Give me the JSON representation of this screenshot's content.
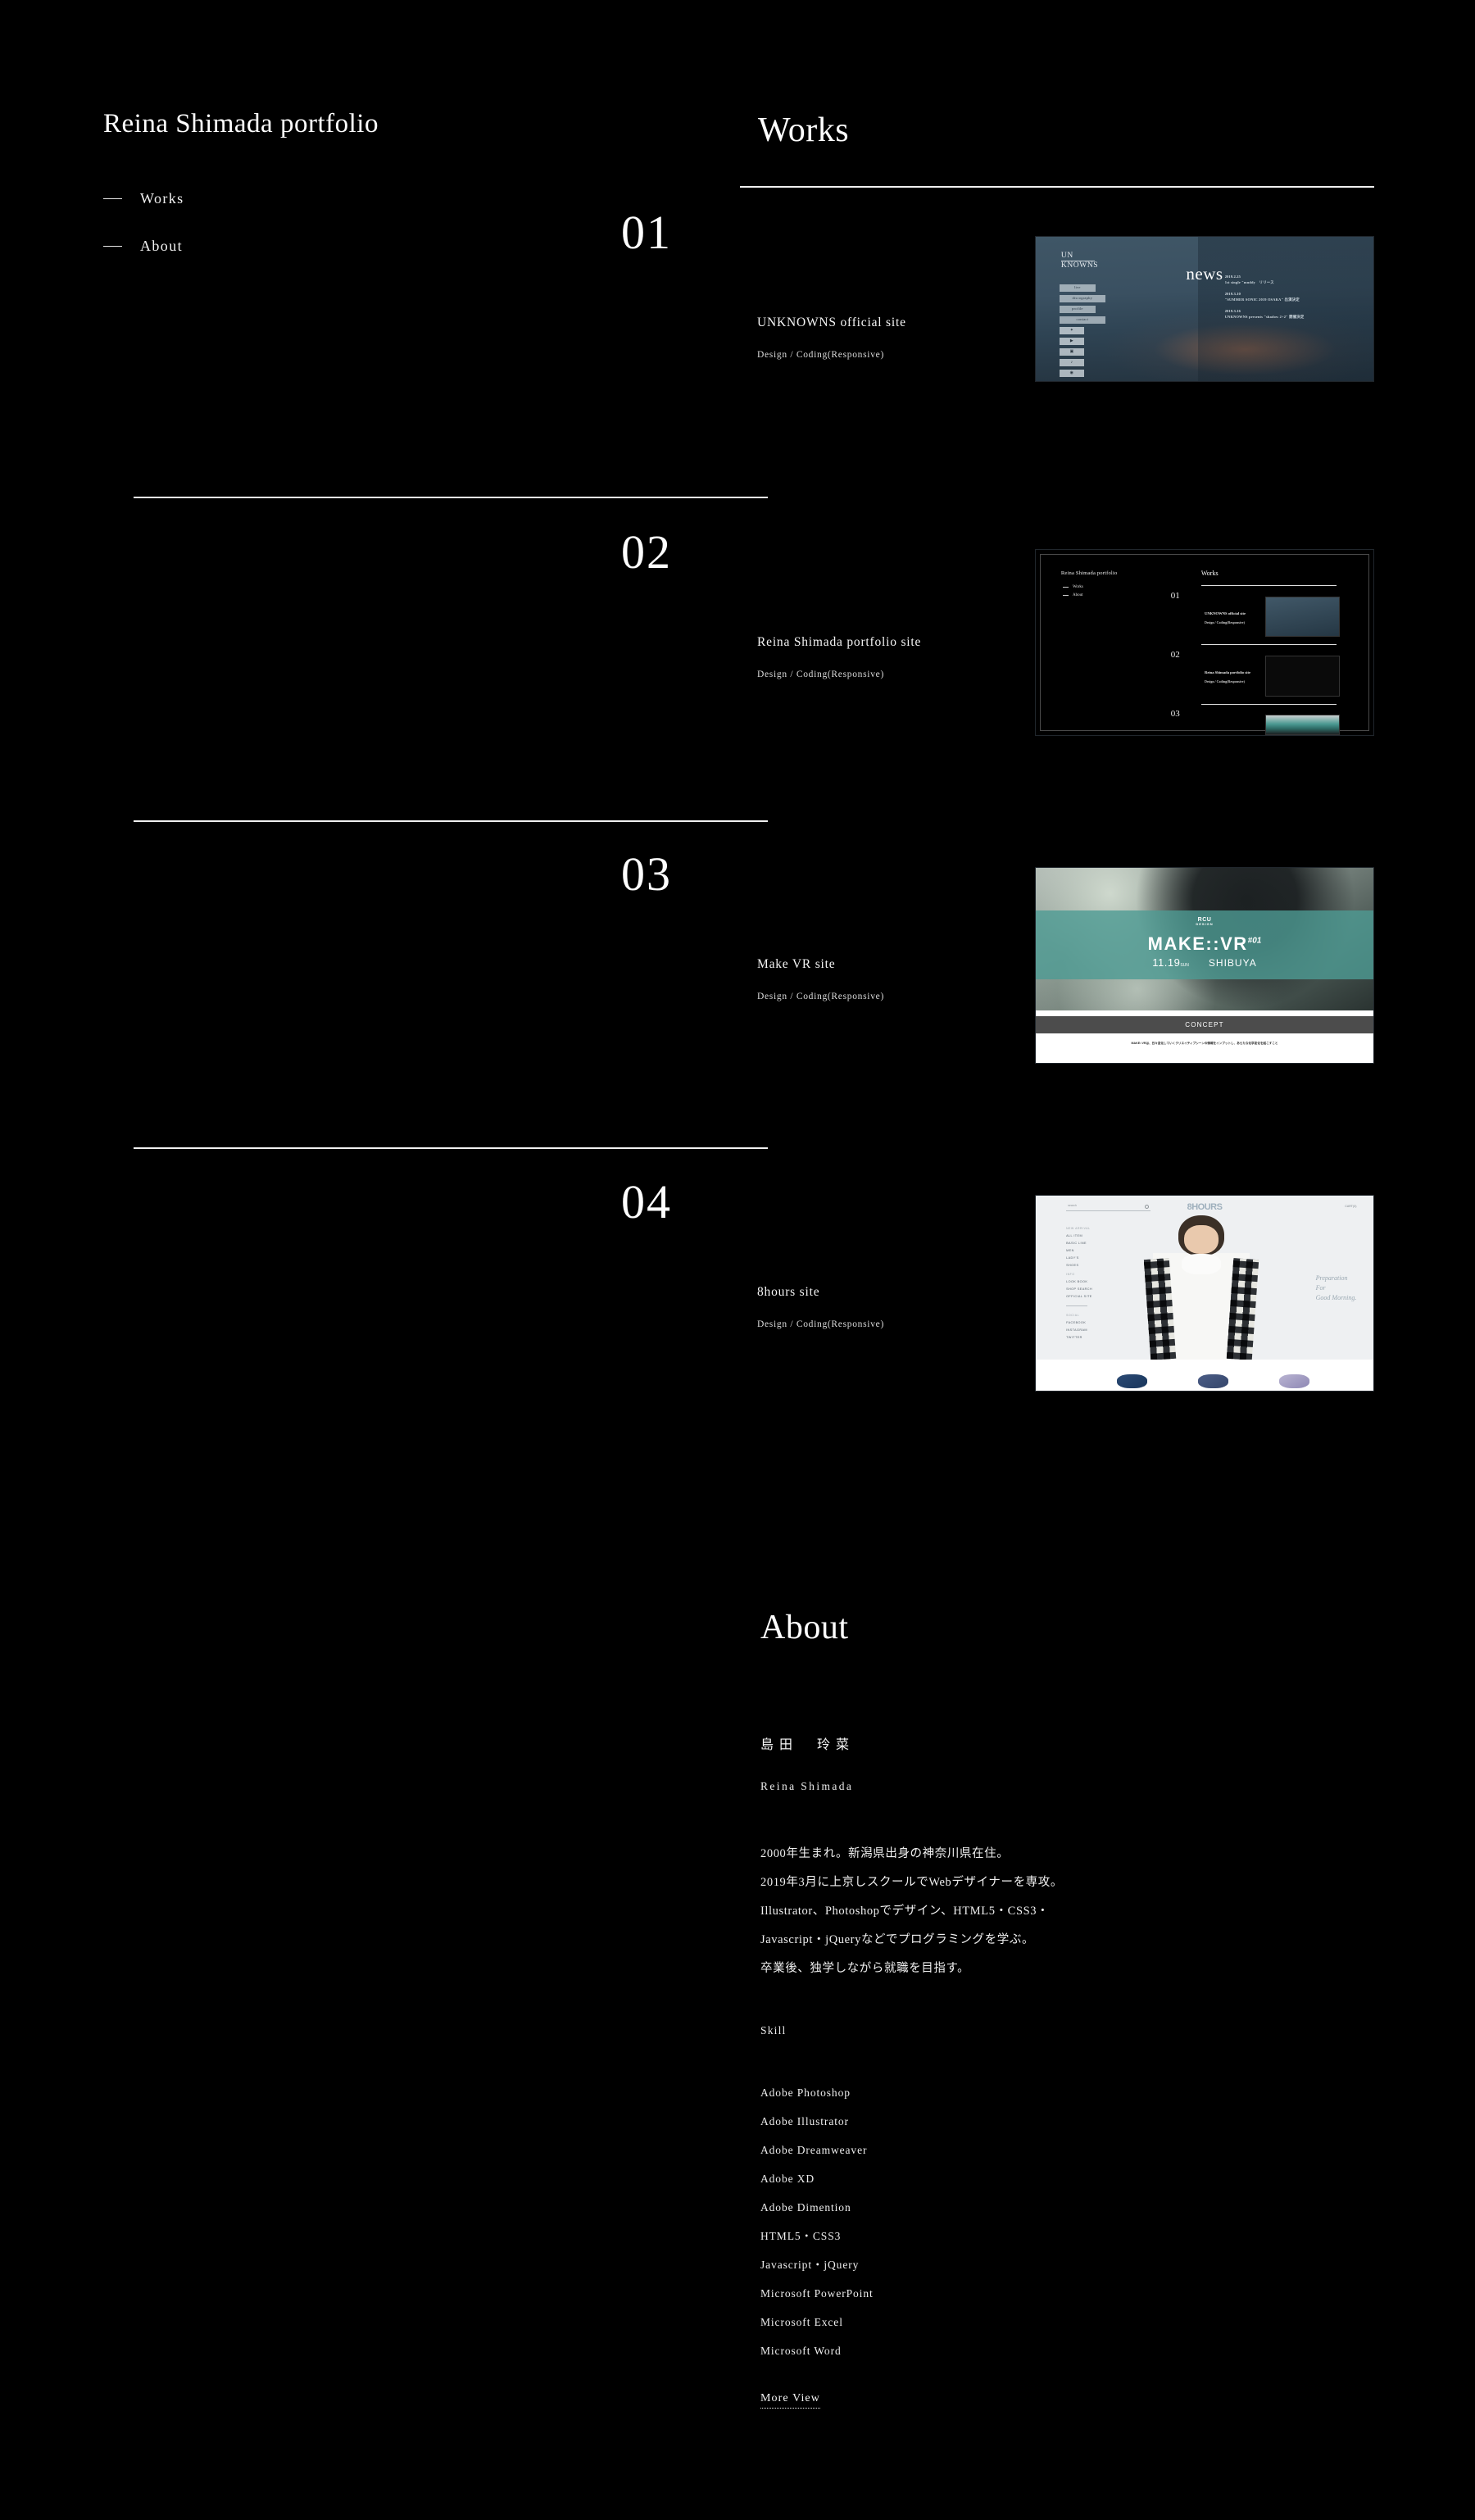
{
  "site": {
    "title": "Reina Shimada portfolio",
    "background_color": "#000000",
    "text_color": "#ffffff"
  },
  "nav": {
    "items": [
      {
        "label": "Works"
      },
      {
        "label": "About"
      }
    ]
  },
  "works": {
    "heading": "Works",
    "items": [
      {
        "index": "01",
        "title": "UNKNOWNS official site",
        "role": "Design / Coding(Responsive)",
        "thumbnail": {
          "kind": "unknowns-band-site",
          "logo_line1": "UN",
          "logo_line2": "KNOWNS",
          "hero_heading": "news",
          "menu": [
            "live",
            "discography",
            "profile",
            "contact"
          ],
          "social_icons": [
            "twitter-icon",
            "youtube-icon",
            "instagram-icon",
            "apple-music-icon",
            "spotify-icon"
          ],
          "news": [
            {
              "date": "2019.2.25",
              "text": "1st single \"muddy　リリース"
            },
            {
              "date": "2019.3.10",
              "text": "\"SUMMER SONIC 2019 OSAKA\" 出演決定"
            },
            {
              "date": "2019.3.16",
              "text": "UNKNOWNS presents \"shadow 2+2\" 開催決定"
            }
          ]
        }
      },
      {
        "index": "02",
        "title": "Reina Shimada portfolio site",
        "role": "Design / Coding(Responsive)",
        "thumbnail": {
          "kind": "recursive-portfolio",
          "title": "Reina Shimada portfolio",
          "nav": [
            "Works",
            "About"
          ],
          "works_heading": "Works",
          "rows": [
            {
              "index": "01",
              "title": "UNKNOWNS official site",
              "role": "Design / Coding(Responsive)"
            },
            {
              "index": "02",
              "title": "Reina Shimada portfolio site",
              "role": "Design / Coding(Responsive)"
            },
            {
              "index": "03",
              "title": "",
              "role": ""
            }
          ]
        }
      },
      {
        "index": "03",
        "title": "Make VR site",
        "role": "Design / Coding(Responsive)",
        "thumbnail": {
          "kind": "make-vr-event",
          "brand": "RCU",
          "brand_sub": "DESIGN",
          "event_title": "MAKE::VR",
          "event_number": "#01",
          "date": "11.19",
          "date_suffix": "SUN",
          "place": "SHIBUYA",
          "section_bar": "CONCEPT",
          "body_text": "MAKE::VRは、日々変化していくクリエイティブシーンの情報をインプットし、あらたな化学変化を起こすこと"
        }
      },
      {
        "index": "04",
        "title": "8hours site",
        "role": "Design / Coding(Responsive)",
        "thumbnail": {
          "kind": "eight-hours-shop",
          "logo": "8HOURS",
          "search_placeholder": "search",
          "cart": "CART(0)",
          "groups": [
            {
              "label": "NEW ARRIVAL",
              "links": [
                "ALL ITEM",
                "BASIC LINE",
                "MEN",
                "LADY'S",
                "SHOES"
              ]
            },
            {
              "label": "INFO",
              "links": [
                "LOOK BOOK",
                "SHOP SEARCH",
                "OFFICIAL SITE"
              ]
            },
            {
              "label": "SOCIAL",
              "links": [
                "FACEBOOK",
                "INSTAGRAM",
                "TWITTER"
              ]
            }
          ],
          "catch_copy_line1": "Preparation",
          "catch_copy_line2": "For",
          "catch_copy_line3": "Good Morning."
        }
      }
    ]
  },
  "about": {
    "heading": "About",
    "name_jp": "島田　玲菜",
    "name_en": "Reina Shimada",
    "bio": [
      "2000年生まれ。新潟県出身の神奈川県在住。",
      "2019年3月に上京しスクールでWebデザイナーを専攻。",
      "Illustrator、Photoshopでデザイン、HTML5・CSS3・",
      "Javascript・jQueryなどでプログラミングを学ぶ。",
      "卒業後、独学しながら就職を目指す。"
    ],
    "skill_label": "Skill",
    "skills": [
      "Adobe Photoshop",
      "Adobe Illustrator",
      "Adobe Dreamweaver",
      "Adobe XD",
      "Adobe Dimention",
      "HTML5・CSS3",
      "Javascript・jQuery",
      "Microsoft PowerPoint",
      "Microsoft Excel",
      "Microsoft Word"
    ],
    "more_view": "More View"
  }
}
